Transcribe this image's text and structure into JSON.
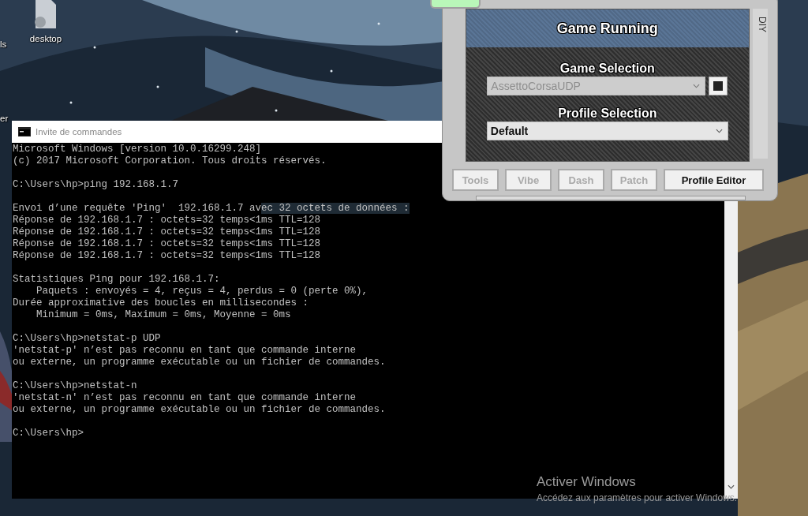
{
  "desktop": {
    "icons": [
      {
        "label": "ls",
        "kind": "label"
      },
      {
        "label": "desktop",
        "kind": "file"
      },
      {
        "label": "er",
        "kind": "label"
      }
    ]
  },
  "console_window": {
    "title": "Invite de commandes",
    "lines": [
      {
        "kind": "text",
        "text": "Microsoft Windows [version 10.0.16299.248]"
      },
      {
        "kind": "text",
        "text": "(c) 2017 Microsoft Corporation. Tous droits réservés."
      },
      {
        "kind": "blank"
      },
      {
        "kind": "text",
        "text": "C:\\Users\\hp>ping 192.168.1.7"
      },
      {
        "kind": "blank"
      },
      {
        "kind": "split",
        "segments": [
          {
            "text": "Envoi d’une requête 'Ping'  192.168.1.7 av",
            "selected": false
          },
          {
            "text": "ec 32 octets de données :",
            "selected": true
          }
        ]
      },
      {
        "kind": "text",
        "text": "Réponse de 192.168.1.7 : octets=32 temps<1ms TTL=128"
      },
      {
        "kind": "text",
        "text": "Réponse de 192.168.1.7 : octets=32 temps<1ms TTL=128"
      },
      {
        "kind": "text",
        "text": "Réponse de 192.168.1.7 : octets=32 temps<1ms TTL=128"
      },
      {
        "kind": "text",
        "text": "Réponse de 192.168.1.7 : octets=32 temps<1ms TTL=128"
      },
      {
        "kind": "blank"
      },
      {
        "kind": "text",
        "text": "Statistiques Ping pour 192.168.1.7:"
      },
      {
        "kind": "text",
        "text": "    Paquets : envoyés = 4, reçus = 4, perdus = 0 (perte 0%),"
      },
      {
        "kind": "text",
        "text": "Durée approximative des boucles en millisecondes :"
      },
      {
        "kind": "text",
        "text": "    Minimum = 0ms, Maximum = 0ms, Moyenne = 0ms"
      },
      {
        "kind": "blank"
      },
      {
        "kind": "text",
        "text": "C:\\Users\\hp>netstat-p UDP"
      },
      {
        "kind": "text",
        "text": "'netstat-p' n’est pas reconnu en tant que commande interne"
      },
      {
        "kind": "text",
        "text": "ou externe, un programme exécutable ou un fichier de commandes."
      },
      {
        "kind": "blank"
      },
      {
        "kind": "text",
        "text": "C:\\Users\\hp>netstat-n"
      },
      {
        "kind": "text",
        "text": "'netstat-n' n’est pas reconnu en tant que commande interne"
      },
      {
        "kind": "text",
        "text": "ou externe, un programme exécutable ou un fichier de commandes."
      },
      {
        "kind": "blank"
      },
      {
        "kind": "text",
        "text": "C:\\Users\\hp>"
      }
    ]
  },
  "game_window": {
    "status": "Game Running",
    "side_tab": "DIY",
    "game_selection": {
      "label": "Game Selection",
      "value": "AssettoCorsaUDP",
      "disabled": true
    },
    "profile_selection": {
      "label": "Profile Selection",
      "value": "Default",
      "disabled": false
    },
    "buttons": [
      {
        "label": "Tools",
        "disabled": true
      },
      {
        "label": "Vibe",
        "disabled": true
      },
      {
        "label": "Dash",
        "disabled": true
      },
      {
        "label": "Patch",
        "disabled": true
      },
      {
        "label": "Profile Editor",
        "disabled": false
      }
    ]
  },
  "activation_notice": {
    "title": "Activer Windows",
    "subtitle": "Accédez aux paramètres pour activer Windows."
  }
}
